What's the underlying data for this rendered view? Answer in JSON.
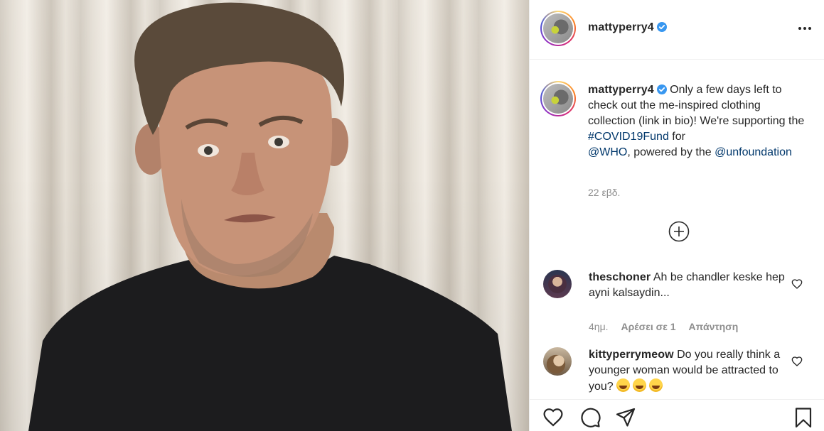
{
  "post": {
    "username": "mattyperry4",
    "verified": true,
    "caption": {
      "part1": "Only a few days left to check out the me-inspired clothing collection (link in bio)! We're supporting the ",
      "hashtag": "#COVID19Fund",
      "part2": " for ",
      "mention1": "@WHO",
      "part3": ", powered by the ",
      "mention2": "@unfoundation"
    },
    "time": "22 εβδ."
  },
  "comments": [
    {
      "username": "theschoner",
      "text": "Ah be chandler keske hep ayni kalsaydin...",
      "time": "4ημ.",
      "likes_label": "Αρέσει σε 1",
      "reply_label": "Απάντηση"
    },
    {
      "username": "kittyperrymeow",
      "text": "Do you really think a younger woman would be attracted to you?",
      "emoji_count": 3
    }
  ],
  "icons": {
    "more": "more-options-icon",
    "load_more": "plus-circle-icon",
    "like": "heart-icon",
    "comment": "comment-icon",
    "share": "paper-plane-icon",
    "save": "bookmark-icon",
    "verified": "verified-badge-icon"
  },
  "colors": {
    "link": "#00376b",
    "verified": "#3897f0",
    "muted": "#8e8e8e"
  }
}
